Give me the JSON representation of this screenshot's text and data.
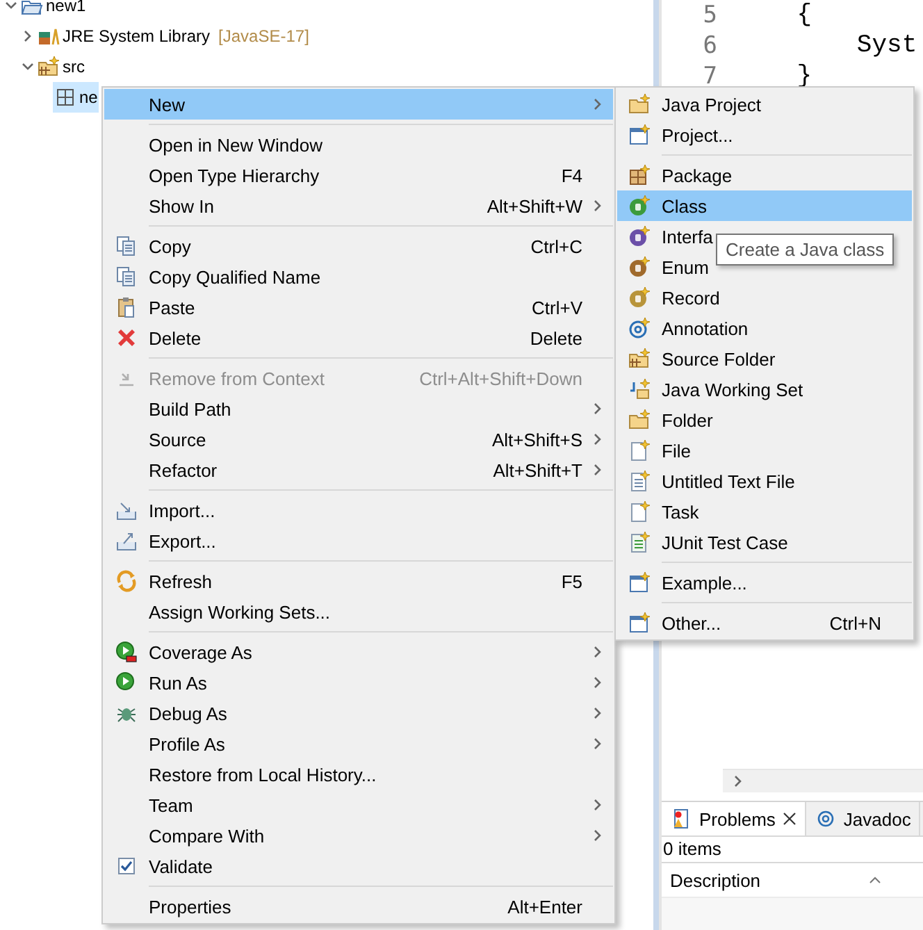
{
  "tree": [
    {
      "label": "new1",
      "expanded": true,
      "children": [
        {
          "label": "JRE System Library",
          "decoration": "[JavaSE-17]",
          "expanded": false
        },
        {
          "label": "src",
          "expanded": true,
          "children": [
            {
              "label": "ne",
              "selected": true
            }
          ]
        }
      ]
    }
  ],
  "editor": {
    "lines": [
      {
        "number": "5",
        "code": "    {"
      },
      {
        "number": "6",
        "code": "        Syst"
      },
      {
        "number": "7",
        "code": "    }"
      }
    ]
  },
  "problems": {
    "tabs": [
      {
        "label": "Problems",
        "selected": true,
        "closable": true
      },
      {
        "label": "Javadoc",
        "selected": false,
        "closable": false
      }
    ],
    "summary": "0 items",
    "columns": [
      "Description"
    ]
  },
  "context_menu": {
    "items": [
      {
        "kind": "item",
        "label": "New",
        "submenu": true,
        "selected": true,
        "disabled": false
      },
      {
        "kind": "separator"
      },
      {
        "kind": "item",
        "label": "Open in New Window",
        "submenu": false,
        "selected": false,
        "disabled": false
      },
      {
        "kind": "item",
        "label": "Open Type Hierarchy",
        "shortcut": "F4",
        "submenu": false,
        "selected": false,
        "disabled": false
      },
      {
        "kind": "item",
        "label": "Show In",
        "shortcut": "Alt+Shift+W",
        "submenu": true,
        "selected": false,
        "disabled": false
      },
      {
        "kind": "separator"
      },
      {
        "kind": "item",
        "label": "Copy",
        "shortcut": "Ctrl+C",
        "submenu": false,
        "selected": false,
        "disabled": false
      },
      {
        "kind": "item",
        "label": "Copy Qualified Name",
        "submenu": false,
        "selected": false,
        "disabled": false
      },
      {
        "kind": "item",
        "label": "Paste",
        "shortcut": "Ctrl+V",
        "submenu": false,
        "selected": false,
        "disabled": false
      },
      {
        "kind": "item",
        "label": "Delete",
        "shortcut": "Delete",
        "submenu": false,
        "selected": false,
        "disabled": false
      },
      {
        "kind": "separator"
      },
      {
        "kind": "item",
        "label": "Remove from Context",
        "shortcut": "Ctrl+Alt+Shift+Down",
        "submenu": false,
        "selected": false,
        "disabled": true
      },
      {
        "kind": "item",
        "label": "Build Path",
        "submenu": true,
        "selected": false,
        "disabled": false
      },
      {
        "kind": "item",
        "label": "Source",
        "shortcut": "Alt+Shift+S",
        "submenu": true,
        "selected": false,
        "disabled": false
      },
      {
        "kind": "item",
        "label": "Refactor",
        "shortcut": "Alt+Shift+T",
        "submenu": true,
        "selected": false,
        "disabled": false
      },
      {
        "kind": "separator"
      },
      {
        "kind": "item",
        "label": "Import...",
        "submenu": false,
        "selected": false,
        "disabled": false
      },
      {
        "kind": "item",
        "label": "Export...",
        "submenu": false,
        "selected": false,
        "disabled": false
      },
      {
        "kind": "separator"
      },
      {
        "kind": "item",
        "label": "Refresh",
        "shortcut": "F5",
        "submenu": false,
        "selected": false,
        "disabled": false
      },
      {
        "kind": "item",
        "label": "Assign Working Sets...",
        "submenu": false,
        "selected": false,
        "disabled": false
      },
      {
        "kind": "separator"
      },
      {
        "kind": "item",
        "label": "Coverage As",
        "submenu": true,
        "selected": false,
        "disabled": false
      },
      {
        "kind": "item",
        "label": "Run As",
        "submenu": true,
        "selected": false,
        "disabled": false
      },
      {
        "kind": "item",
        "label": "Debug As",
        "submenu": true,
        "selected": false,
        "disabled": false
      },
      {
        "kind": "item",
        "label": "Profile As",
        "submenu": true,
        "selected": false,
        "disabled": false
      },
      {
        "kind": "item",
        "label": "Restore from Local History...",
        "submenu": false,
        "selected": false,
        "disabled": false
      },
      {
        "kind": "item",
        "label": "Team",
        "submenu": true,
        "selected": false,
        "disabled": false
      },
      {
        "kind": "item",
        "label": "Compare With",
        "submenu": true,
        "selected": false,
        "disabled": false
      },
      {
        "kind": "item",
        "label": "Validate",
        "submenu": false,
        "selected": false,
        "disabled": false,
        "checked": true
      },
      {
        "kind": "separator"
      },
      {
        "kind": "item",
        "label": "Properties",
        "shortcut": "Alt+Enter",
        "submenu": false,
        "selected": false,
        "disabled": false
      }
    ]
  },
  "submenu": {
    "items": [
      {
        "kind": "item",
        "label": "Java Project",
        "selected": false
      },
      {
        "kind": "item",
        "label": "Project...",
        "selected": false
      },
      {
        "kind": "separator"
      },
      {
        "kind": "item",
        "label": "Package",
        "selected": false
      },
      {
        "kind": "item",
        "label": "Class",
        "selected": true
      },
      {
        "kind": "item",
        "label": "Interfa",
        "selected": false
      },
      {
        "kind": "item",
        "label": "Enum",
        "selected": false
      },
      {
        "kind": "item",
        "label": "Record",
        "selected": false
      },
      {
        "kind": "item",
        "label": "Annotation",
        "selected": false
      },
      {
        "kind": "item",
        "label": "Source Folder",
        "selected": false
      },
      {
        "kind": "item",
        "label": "Java Working Set",
        "selected": false
      },
      {
        "kind": "item",
        "label": "Folder",
        "selected": false
      },
      {
        "kind": "item",
        "label": "File",
        "selected": false
      },
      {
        "kind": "item",
        "label": "Untitled Text File",
        "selected": false
      },
      {
        "kind": "item",
        "label": "Task",
        "selected": false
      },
      {
        "kind": "item",
        "label": "JUnit Test Case",
        "selected": false
      },
      {
        "kind": "separator"
      },
      {
        "kind": "item",
        "label": "Example...",
        "selected": false
      },
      {
        "kind": "separator"
      },
      {
        "kind": "item",
        "label": "Other...",
        "shortcut": "Ctrl+N",
        "selected": false
      }
    ]
  },
  "tooltip": "Create a Java class"
}
